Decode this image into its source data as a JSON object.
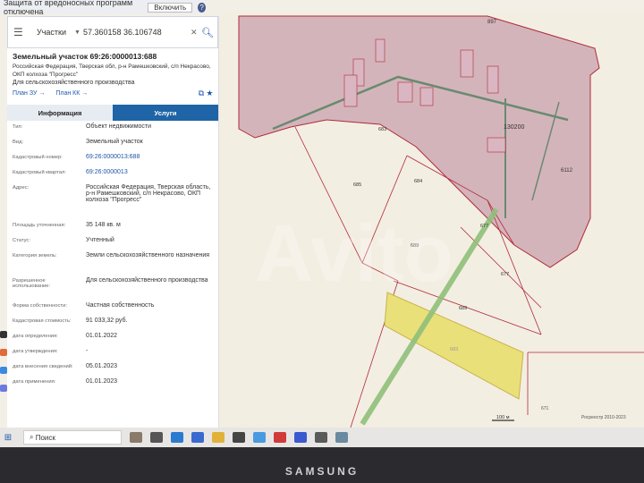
{
  "browser": {
    "warning_text": "Защита от вредоносных программ отключена",
    "warning_button": "Включить",
    "warning_help": "?"
  },
  "search": {
    "category": "Участки",
    "value": "57.360158 36.106748"
  },
  "parcel": {
    "title": "Земельный участок 69:26:0000013:688",
    "address_line": "Российская Федерация, Тверская обл, р-н Рамешковский, с/п Некрасово, ОКП колхоза \"Прогресс\"",
    "purpose": "Для сельскохозяйственного производства",
    "links": [
      "План ЗУ →",
      "План КК →"
    ]
  },
  "tabs": {
    "info": "Информация",
    "services": "Услуги"
  },
  "details": [
    {
      "label": "Тип:",
      "value": "Объект недвижимости"
    },
    {
      "label": "Вид:",
      "value": "Земельный участок"
    },
    {
      "label": "Кадастровый номер:",
      "value": "69:26:0000013:688"
    },
    {
      "label": "Кадастровый квартал:",
      "value": "69:26:0000013"
    },
    {
      "label": "Адрес:",
      "value": "Российская Федерация, Тверская область, р-н Рамешковский, с/п Некрасово, ОКП колхоза \"Прогресс\""
    },
    {
      "label": "Площадь уточненная:",
      "value": "35 148 кв. м"
    },
    {
      "label": "Статус:",
      "value": "Учтенный"
    },
    {
      "label": "Категория земель:",
      "value": "Земли сельскохозяйственного назначения"
    },
    {
      "label": "Разрешенное использование:",
      "value": "Для сельскохозяйственного производства"
    },
    {
      "label": "Форма собственности:",
      "value": "Частная собственность"
    },
    {
      "label": "Кадастровая стоимость:",
      "value": "91 033,32 руб."
    },
    {
      "label": "дата определения:",
      "value": "01.01.2022"
    },
    {
      "label": "дата утверждения:",
      "value": "-"
    },
    {
      "label": "дата внесения сведений:",
      "value": "05.01.2023"
    },
    {
      "label": "дата применения:",
      "value": "01.01.2023"
    }
  ],
  "map": {
    "labels": [
      "897",
      "683",
      "685",
      "684",
      "689",
      "677",
      "677",
      "689",
      "683",
      "671",
      "130200",
      "6112"
    ],
    "scale": "100 м",
    "copyright": "Росреестр 2010-2023",
    "watermark": "Avito"
  },
  "taskbar": {
    "search_placeholder": "Поиск"
  },
  "device": {
    "brand": "SAMSUNG"
  }
}
